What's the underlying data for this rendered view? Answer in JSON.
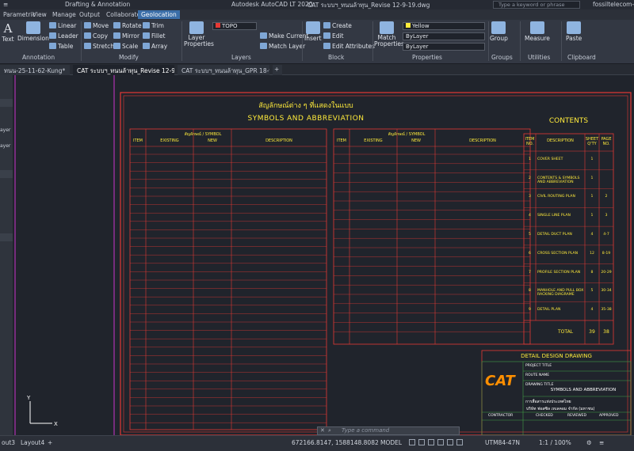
{
  "app": {
    "title": "Autodesk AutoCAD LT 2020",
    "file": "CAT ระบบฯ_ทนนล้าทุน_Revise 12-9-19.dwg",
    "workspace": "Drafting & Annotation",
    "search_placeholder": "Type a keyword or phrase",
    "user": "fossiltelecom-20"
  },
  "ribbon_tabs": [
    "Parametric",
    "View",
    "Manage",
    "Output",
    "Collaborate",
    "Geolocation"
  ],
  "ribbon": {
    "text": "Text",
    "dimension": "Dimension",
    "linear": "Linear",
    "leader": "Leader",
    "table": "Table",
    "move": "Move",
    "rotate": "Rotate",
    "trim": "Trim",
    "copy": "Copy",
    "mirror": "Mirror",
    "fillet": "Fillet",
    "stretch": "Stretch",
    "scale": "Scale",
    "array": "Array",
    "layer_properties": "Layer Properties",
    "layer_combo": "TOPO",
    "make_current": "Make Current",
    "match_layer": "Match Layer",
    "insert": "Insert",
    "create": "Create",
    "edit": "Edit",
    "edit_attributes": "Edit Attributes",
    "match_properties": "Match Properties",
    "color_combo": "Yellow",
    "linetype_combo": "ByLayer",
    "lineweight_combo": "ByLayer",
    "group": "Group",
    "measure": "Measure",
    "paste": "Paste",
    "panels": [
      "Annotation",
      "Modify",
      "Layers",
      "Block",
      "Properties",
      "Groups",
      "Utilities",
      "Clipboard"
    ]
  },
  "doc_tabs": [
    "ทนน-25-11-62-Kung*",
    "CAT ระบบฯ_ทนนล้าทุน_Revise 12-9-19*",
    "CAT ระบบฯ_ทนนล้าทุน_GPR 18-9-19*"
  ],
  "palette_items": [
    "ayer",
    "ayer"
  ],
  "drawing": {
    "title_th": "สัญลักษณ์ต่าง ๆ ที่แสดงในแบบ",
    "title_en": "SYMBOLS AND ABBREVIATION",
    "table_header": [
      "ITEM",
      "EXISTING",
      "NEW",
      "DESCRIPTION"
    ],
    "group_label": "สัญลักษณ์ / SYMBOL",
    "contents_title": "CONTENTS",
    "contents_header": [
      "ITEM NO.",
      "DESCRIPTION",
      "SHEET Q'TY",
      "PAGE NO."
    ],
    "contents": [
      {
        "no": "1",
        "desc": "COVER SHEET",
        "qty": "1",
        "page": ""
      },
      {
        "no": "2",
        "desc": "CONTENTS & SYMBOLS AND ABBREVIATION",
        "qty": "1",
        "page": ""
      },
      {
        "no": "3",
        "desc": "CIVIL ROUTING PLAN",
        "qty": "1",
        "page": "2"
      },
      {
        "no": "4",
        "desc": "SINGLE LINE PLAN",
        "qty": "1",
        "page": "3"
      },
      {
        "no": "5",
        "desc": "DETAIL DUCT PLAN",
        "qty": "4",
        "page": "4-7"
      },
      {
        "no": "6",
        "desc": "CROSS SECTION PLAN",
        "qty": "12",
        "page": "8-19"
      },
      {
        "no": "7",
        "desc": "PROFILE SECTION PLAN",
        "qty": "8",
        "page": "20-29"
      },
      {
        "no": "8",
        "desc": "MANHOLE AND PULL BOX RACKING DIAGRAME",
        "qty": "5",
        "page": "30-34"
      },
      {
        "no": "9",
        "desc": "DETAIL PLAN",
        "qty": "4",
        "page": "35-38"
      }
    ],
    "contents_total_label": "TOTAL",
    "contents_total_qty": "39",
    "contents_total_page": "38",
    "titleblock_title": "DETAIL DESIGN DRAWING",
    "project_title_label": "PROJECT TITLE",
    "route_name_label": "ROUTE NAME",
    "drawing_title_label": "DRAWING TITLE",
    "drawing_title": "SYMBOLS AND ABBREVIATION",
    "logo": "CAT",
    "owner_th": "การสื่อสารแห่งประเทศไทย",
    "company_th": "บริษัท ฟอสซิล เทเลคอม จำกัด (มหาชน)",
    "contractor_label": "CONTRACTOR",
    "checked_label": "CHECKED",
    "reviewed_label": "REVIEWED",
    "approved_label": "APPROVED"
  },
  "command_placeholder": "Type a command",
  "layout_tabs": [
    "out3",
    "Layout4"
  ],
  "status": {
    "coords": "672166.8147, 1588148.8082",
    "model": "MODEL",
    "coord_system": "UTM84-47N",
    "scale": "1:1 / 100%"
  }
}
